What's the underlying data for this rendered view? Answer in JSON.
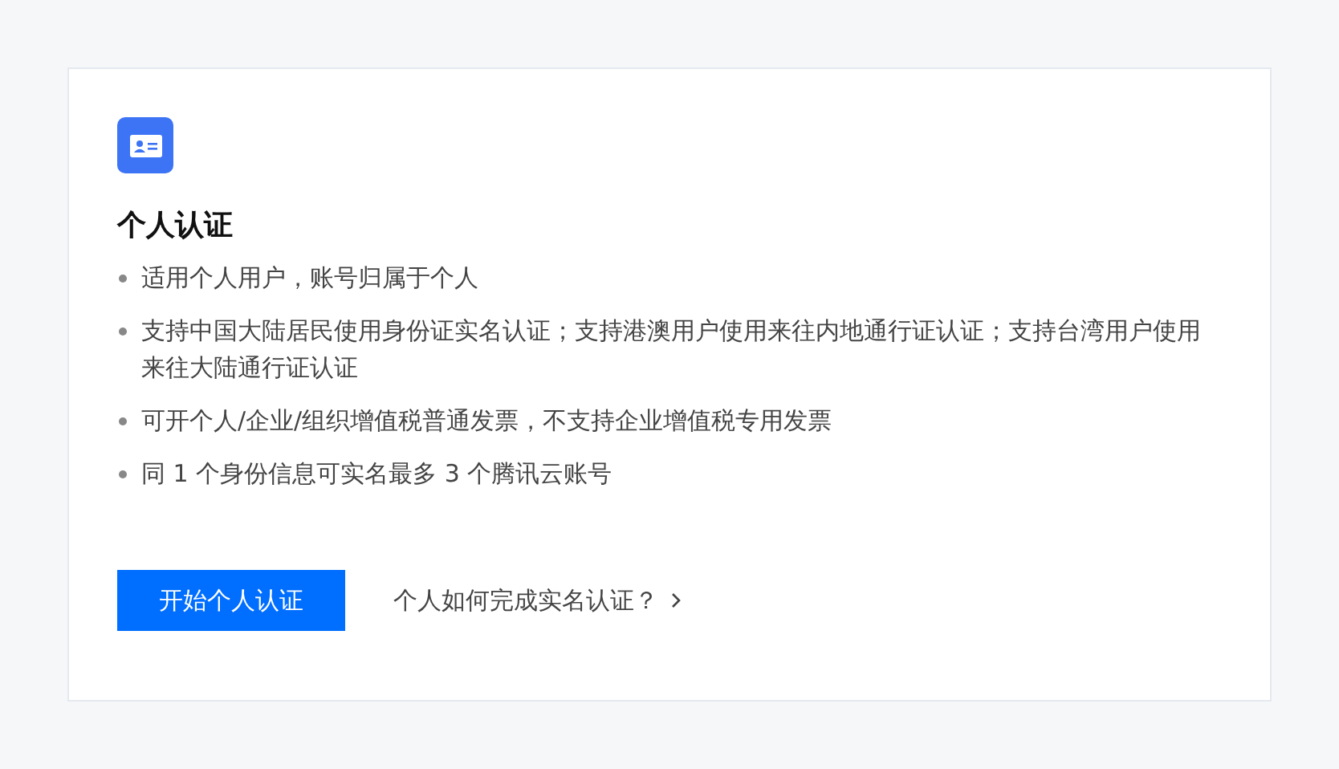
{
  "card": {
    "title": "个人认证",
    "features": [
      "适用个人用户，账号归属于个人",
      "支持中国大陆居民使用身份证实名认证；支持港澳用户使用来往内地通行证认证；支持台湾用户使用来往大陆通行证认证",
      "可开个人/企业/组织增值税普通发票，不支持企业增值税专用发票",
      "同 1 个身份信息可实名最多 3 个腾讯云账号"
    ],
    "primary_button": "开始个人认证",
    "help_link": "个人如何完成实名认证？"
  }
}
